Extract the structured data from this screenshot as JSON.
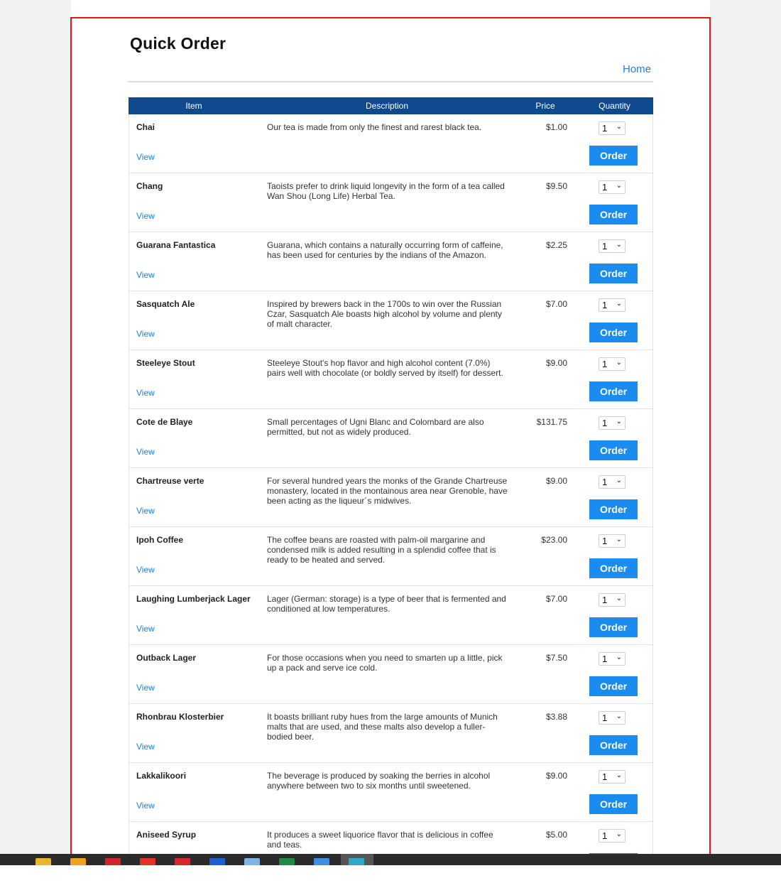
{
  "page": {
    "title": "Quick Order",
    "home_link": "Home"
  },
  "table": {
    "headers": {
      "item": "Item",
      "description": "Description",
      "price": "Price",
      "quantity": "Quantity"
    },
    "view_label": "View",
    "order_label": "Order",
    "rows": [
      {
        "item": "Chai",
        "description": "Our tea is made from only the finest and rarest black tea.",
        "price": "$1.00",
        "qty": "1"
      },
      {
        "item": "Chang",
        "description": "Taoists prefer to drink liquid longevity in the form of a tea called Wan Shou (Long Life) Herbal Tea.",
        "price": "$9.50",
        "qty": "1"
      },
      {
        "item": "Guarana Fantastica",
        "description": "Guarana, which contains a naturally occurring form of caffeine, has been used for centuries by the indians of the Amazon.",
        "price": "$2.25",
        "qty": "1"
      },
      {
        "item": "Sasquatch Ale",
        "description": "Inspired by brewers back in the 1700s to win over the Russian Czar, Sasquatch Ale boasts high alcohol by volume and plenty of malt character.",
        "price": "$7.00",
        "qty": "1"
      },
      {
        "item": "Steeleye Stout",
        "description": "Steeleye Stout's hop flavor and high alcohol content (7.0%) pairs well with chocolate (or boldly served by itself) for dessert.",
        "price": "$9.00",
        "qty": "1"
      },
      {
        "item": "Cote de Blaye",
        "description": "Small percentages of Ugni Blanc and Colombard are also permitted, but not as widely produced.",
        "price": "$131.75",
        "qty": "1"
      },
      {
        "item": "Chartreuse verte",
        "description": "For several hundred years the monks of the Grande Chartreuse monastery, located in the montainous area near Grenoble, have been acting as the liqueur´s midwives.",
        "price": "$9.00",
        "qty": "1"
      },
      {
        "item": "Ipoh Coffee",
        "description": "The coffee beans are roasted with palm-oil margarine and condensed milk is added resulting in a splendid coffee that is ready to be heated and served.",
        "price": "$23.00",
        "qty": "1"
      },
      {
        "item": "Laughing Lumberjack Lager",
        "description": "Lager (German: storage) is a type of beer that is fermented and conditioned at low temperatures.",
        "price": "$7.00",
        "qty": "1"
      },
      {
        "item": "Outback Lager",
        "description": "For those occasions when you need to smarten up a little, pick up a pack and serve ice cold.",
        "price": "$7.50",
        "qty": "1"
      },
      {
        "item": "Rhonbrau Klosterbier",
        "description": "It boasts brilliant ruby hues from the large amounts of Munich malts that are used, and these malts also develop a fuller-bodied beer.",
        "price": "$3.88",
        "qty": "1"
      },
      {
        "item": "Lakkalikoori",
        "description": "The beverage is produced by soaking the berries in alcohol anywhere between two to six months until sweetened.",
        "price": "$9.00",
        "qty": "1"
      },
      {
        "item": "Aniseed Syrup",
        "description": "It produces a sweet liquorice flavor that is delicious in coffee and teas.",
        "price": "$5.00",
        "qty": "1"
      }
    ]
  },
  "taskbar": {
    "icons": [
      {
        "name": "file-explorer-icon",
        "color": "#e8b530"
      },
      {
        "name": "calendar-icon",
        "color": "#f0a11c"
      },
      {
        "name": "mail-icon",
        "color": "#d2242a"
      },
      {
        "name": "chrome-icon",
        "color": "#e4322b"
      },
      {
        "name": "app-red-icon",
        "color": "#d8262e"
      },
      {
        "name": "teams-icon",
        "color": "#1d5fcf"
      },
      {
        "name": "cloud-icon",
        "color": "#7fb4e0"
      },
      {
        "name": "excel-icon",
        "color": "#1e8a45"
      },
      {
        "name": "app-blue-icon",
        "color": "#3f8fe0"
      },
      {
        "name": "browser-icon",
        "color": "#2fa8c8"
      }
    ]
  }
}
